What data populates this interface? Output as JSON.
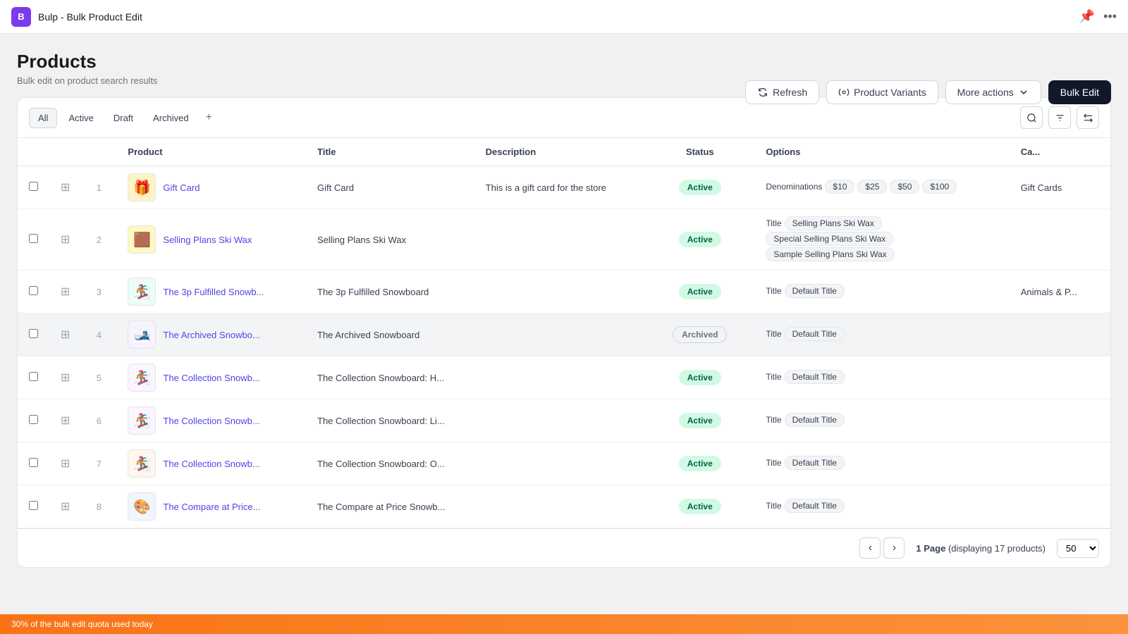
{
  "app": {
    "icon_label": "B",
    "title": "Bulp - Bulk Product Edit"
  },
  "header": {
    "page_title": "Products",
    "page_subtitle": "Bulk edit on product search results",
    "buttons": {
      "refresh": "Refresh",
      "product_variants": "Product Variants",
      "more_actions": "More actions",
      "bulk_edit": "Bulk Edit"
    }
  },
  "tabs": [
    {
      "label": "All",
      "key": "all",
      "active": true
    },
    {
      "label": "Active",
      "key": "active"
    },
    {
      "label": "Draft",
      "key": "draft"
    },
    {
      "label": "Archived",
      "key": "archived"
    }
  ],
  "table": {
    "columns": [
      "Product",
      "Title",
      "Description",
      "Status",
      "Options",
      "Ca..."
    ],
    "rows": [
      {
        "num": 1,
        "thumb_emoji": "🎁",
        "thumb_bg": "#fef3c7",
        "product_name": "Gift Card",
        "title": "Gift Card",
        "description": "This is a gift card for the store",
        "status": "Active",
        "options": [
          {
            "label": "Denominations",
            "tags": [
              "$10",
              "$25",
              "$50",
              "$100"
            ]
          }
        ],
        "category": "Gift Cards",
        "archived": false
      },
      {
        "num": 2,
        "thumb_emoji": "🟫",
        "thumb_bg": "#fef9c3",
        "product_name": "Selling Plans Ski Wax",
        "title": "Selling Plans Ski Wax",
        "description": "",
        "status": "Active",
        "options": [
          {
            "label": "Title",
            "tags": [
              "Selling Plans Ski Wax"
            ]
          },
          {
            "label": "",
            "tags": [
              "Special Selling Plans Ski Wax"
            ]
          },
          {
            "label": "",
            "tags": [
              "Sample Selling Plans Ski Wax"
            ]
          }
        ],
        "category": "",
        "archived": false
      },
      {
        "num": 3,
        "thumb_emoji": "🏂",
        "thumb_bg": "#ecfdf5",
        "product_name": "The 3p Fulfilled Snowb...",
        "title": "The 3p Fulfilled Snowboard",
        "description": "",
        "status": "Active",
        "options": [
          {
            "label": "Title",
            "tags": [
              "Default Title"
            ]
          }
        ],
        "category": "Animals & P...",
        "archived": false
      },
      {
        "num": 4,
        "thumb_emoji": "🎿",
        "thumb_bg": "#f5f3ff",
        "product_name": "The Archived Snowbo...",
        "title": "The Archived Snowboard",
        "description": "",
        "status": "Archived",
        "options": [
          {
            "label": "Title",
            "tags": [
              "Default Title"
            ]
          }
        ],
        "category": "",
        "archived": true
      },
      {
        "num": 5,
        "thumb_emoji": "🏂",
        "thumb_bg": "#faf5ff",
        "product_name": "The Collection Snowb...",
        "title": "The Collection Snowboard: H...",
        "description": "",
        "status": "Active",
        "options": [
          {
            "label": "Title",
            "tags": [
              "Default Title"
            ]
          }
        ],
        "category": "",
        "archived": false
      },
      {
        "num": 6,
        "thumb_emoji": "🏂",
        "thumb_bg": "#faf5ff",
        "product_name": "The Collection Snowb...",
        "title": "The Collection Snowboard: Li...",
        "description": "",
        "status": "Active",
        "options": [
          {
            "label": "Title",
            "tags": [
              "Default Title"
            ]
          }
        ],
        "category": "",
        "archived": false
      },
      {
        "num": 7,
        "thumb_emoji": "🏂",
        "thumb_bg": "#fff7ed",
        "product_name": "The Collection Snowb...",
        "title": "The Collection Snowboard: O...",
        "description": "",
        "status": "Active",
        "options": [
          {
            "label": "Title",
            "tags": [
              "Default Title"
            ]
          }
        ],
        "category": "",
        "archived": false
      },
      {
        "num": 8,
        "thumb_emoji": "🎨",
        "thumb_bg": "#eff6ff",
        "product_name": "The Compare at Price...",
        "title": "The Compare at Price Snowb...",
        "description": "",
        "status": "Active",
        "options": [
          {
            "label": "Title",
            "tags": [
              "Default Title"
            ]
          }
        ],
        "category": "",
        "archived": false
      }
    ]
  },
  "footer": {
    "page_label": "1 Page",
    "displaying": "(displaying 17 products)",
    "per_page": "50"
  },
  "bottom_bar": {
    "text": "30% of the bulk edit quota used today"
  }
}
